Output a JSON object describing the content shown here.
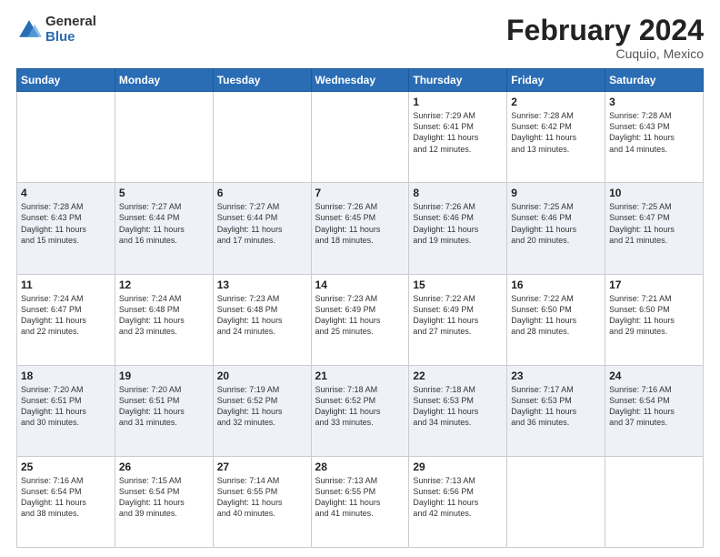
{
  "header": {
    "logo_general": "General",
    "logo_blue": "Blue",
    "title": "February 2024",
    "location": "Cuquio, Mexico"
  },
  "days_of_week": [
    "Sunday",
    "Monday",
    "Tuesday",
    "Wednesday",
    "Thursday",
    "Friday",
    "Saturday"
  ],
  "weeks": [
    {
      "cells": [
        {
          "day": "",
          "info": ""
        },
        {
          "day": "",
          "info": ""
        },
        {
          "day": "",
          "info": ""
        },
        {
          "day": "",
          "info": ""
        },
        {
          "day": "1",
          "info": "Sunrise: 7:29 AM\nSunset: 6:41 PM\nDaylight: 11 hours\nand 12 minutes."
        },
        {
          "day": "2",
          "info": "Sunrise: 7:28 AM\nSunset: 6:42 PM\nDaylight: 11 hours\nand 13 minutes."
        },
        {
          "day": "3",
          "info": "Sunrise: 7:28 AM\nSunset: 6:43 PM\nDaylight: 11 hours\nand 14 minutes."
        }
      ]
    },
    {
      "cells": [
        {
          "day": "4",
          "info": "Sunrise: 7:28 AM\nSunset: 6:43 PM\nDaylight: 11 hours\nand 15 minutes."
        },
        {
          "day": "5",
          "info": "Sunrise: 7:27 AM\nSunset: 6:44 PM\nDaylight: 11 hours\nand 16 minutes."
        },
        {
          "day": "6",
          "info": "Sunrise: 7:27 AM\nSunset: 6:44 PM\nDaylight: 11 hours\nand 17 minutes."
        },
        {
          "day": "7",
          "info": "Sunrise: 7:26 AM\nSunset: 6:45 PM\nDaylight: 11 hours\nand 18 minutes."
        },
        {
          "day": "8",
          "info": "Sunrise: 7:26 AM\nSunset: 6:46 PM\nDaylight: 11 hours\nand 19 minutes."
        },
        {
          "day": "9",
          "info": "Sunrise: 7:25 AM\nSunset: 6:46 PM\nDaylight: 11 hours\nand 20 minutes."
        },
        {
          "day": "10",
          "info": "Sunrise: 7:25 AM\nSunset: 6:47 PM\nDaylight: 11 hours\nand 21 minutes."
        }
      ]
    },
    {
      "cells": [
        {
          "day": "11",
          "info": "Sunrise: 7:24 AM\nSunset: 6:47 PM\nDaylight: 11 hours\nand 22 minutes."
        },
        {
          "day": "12",
          "info": "Sunrise: 7:24 AM\nSunset: 6:48 PM\nDaylight: 11 hours\nand 23 minutes."
        },
        {
          "day": "13",
          "info": "Sunrise: 7:23 AM\nSunset: 6:48 PM\nDaylight: 11 hours\nand 24 minutes."
        },
        {
          "day": "14",
          "info": "Sunrise: 7:23 AM\nSunset: 6:49 PM\nDaylight: 11 hours\nand 25 minutes."
        },
        {
          "day": "15",
          "info": "Sunrise: 7:22 AM\nSunset: 6:49 PM\nDaylight: 11 hours\nand 27 minutes."
        },
        {
          "day": "16",
          "info": "Sunrise: 7:22 AM\nSunset: 6:50 PM\nDaylight: 11 hours\nand 28 minutes."
        },
        {
          "day": "17",
          "info": "Sunrise: 7:21 AM\nSunset: 6:50 PM\nDaylight: 11 hours\nand 29 minutes."
        }
      ]
    },
    {
      "cells": [
        {
          "day": "18",
          "info": "Sunrise: 7:20 AM\nSunset: 6:51 PM\nDaylight: 11 hours\nand 30 minutes."
        },
        {
          "day": "19",
          "info": "Sunrise: 7:20 AM\nSunset: 6:51 PM\nDaylight: 11 hours\nand 31 minutes."
        },
        {
          "day": "20",
          "info": "Sunrise: 7:19 AM\nSunset: 6:52 PM\nDaylight: 11 hours\nand 32 minutes."
        },
        {
          "day": "21",
          "info": "Sunrise: 7:18 AM\nSunset: 6:52 PM\nDaylight: 11 hours\nand 33 minutes."
        },
        {
          "day": "22",
          "info": "Sunrise: 7:18 AM\nSunset: 6:53 PM\nDaylight: 11 hours\nand 34 minutes."
        },
        {
          "day": "23",
          "info": "Sunrise: 7:17 AM\nSunset: 6:53 PM\nDaylight: 11 hours\nand 36 minutes."
        },
        {
          "day": "24",
          "info": "Sunrise: 7:16 AM\nSunset: 6:54 PM\nDaylight: 11 hours\nand 37 minutes."
        }
      ]
    },
    {
      "cells": [
        {
          "day": "25",
          "info": "Sunrise: 7:16 AM\nSunset: 6:54 PM\nDaylight: 11 hours\nand 38 minutes."
        },
        {
          "day": "26",
          "info": "Sunrise: 7:15 AM\nSunset: 6:54 PM\nDaylight: 11 hours\nand 39 minutes."
        },
        {
          "day": "27",
          "info": "Sunrise: 7:14 AM\nSunset: 6:55 PM\nDaylight: 11 hours\nand 40 minutes."
        },
        {
          "day": "28",
          "info": "Sunrise: 7:13 AM\nSunset: 6:55 PM\nDaylight: 11 hours\nand 41 minutes."
        },
        {
          "day": "29",
          "info": "Sunrise: 7:13 AM\nSunset: 6:56 PM\nDaylight: 11 hours\nand 42 minutes."
        },
        {
          "day": "",
          "info": ""
        },
        {
          "day": "",
          "info": ""
        }
      ]
    }
  ]
}
